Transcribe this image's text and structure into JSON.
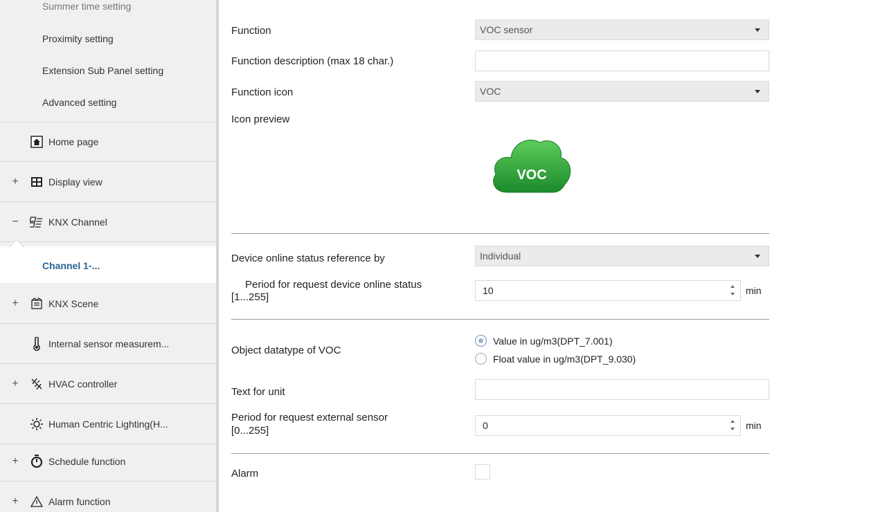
{
  "sidebar": {
    "sub_items": [
      {
        "label": "Summer time setting"
      },
      {
        "label": "Proximity setting"
      },
      {
        "label": "Extension Sub Panel setting"
      },
      {
        "label": "Advanced setting"
      }
    ],
    "main_items": [
      {
        "label": "Home page",
        "expander": "",
        "icon": "home-icon"
      },
      {
        "label": "Display view",
        "expander": "+",
        "icon": "display-view-icon"
      },
      {
        "label": "KNX Channel",
        "expander": "−",
        "icon": "knx-channel-icon"
      },
      {
        "label": "Channel 1-...",
        "expander": "",
        "icon": ""
      },
      {
        "label": "KNX Scene",
        "expander": "+",
        "icon": "scene-icon"
      },
      {
        "label": "Internal sensor measurem...",
        "expander": "",
        "icon": "thermometer-icon"
      },
      {
        "label": "HVAC controller",
        "expander": "+",
        "icon": "hvac-icon"
      },
      {
        "label": "Human Centric Lighting(H...",
        "expander": "",
        "icon": "sun-icon"
      },
      {
        "label": "Schedule function",
        "expander": "+",
        "icon": "timer-icon"
      },
      {
        "label": "Alarm function",
        "expander": "+",
        "icon": "warning-icon"
      }
    ]
  },
  "form": {
    "function_label": "Function",
    "function_value": "VOC sensor",
    "description_label": "Function description (max 18 char.)",
    "description_value": "",
    "icon_label": "Function icon",
    "icon_value": "VOC",
    "preview_label": "Icon preview",
    "preview_text": "VOC",
    "online_ref_label": "Device online status reference by",
    "online_ref_value": "Individual",
    "period_online_label_1": "Period for request device online status",
    "period_online_label_2": "[1...255]",
    "period_online_value": "10",
    "period_online_unit": "min",
    "datatype_label": "Object datatype of VOC",
    "datatype_options": [
      "Value in ug/m3(DPT_7.001)",
      "Float value in ug/m3(DPT_9.030)"
    ],
    "datatype_selected": 0,
    "unit_text_label": "Text for unit",
    "unit_text_value": "",
    "period_ext_label_1": "Period for request external sensor",
    "period_ext_label_2": "[0...255]",
    "period_ext_value": "0",
    "period_ext_unit": "min",
    "alarm_label": "Alarm",
    "alarm_checked": false
  },
  "colors": {
    "selected_item_text": "#2a6496",
    "voc_icon_green": "#2e9e3a"
  }
}
